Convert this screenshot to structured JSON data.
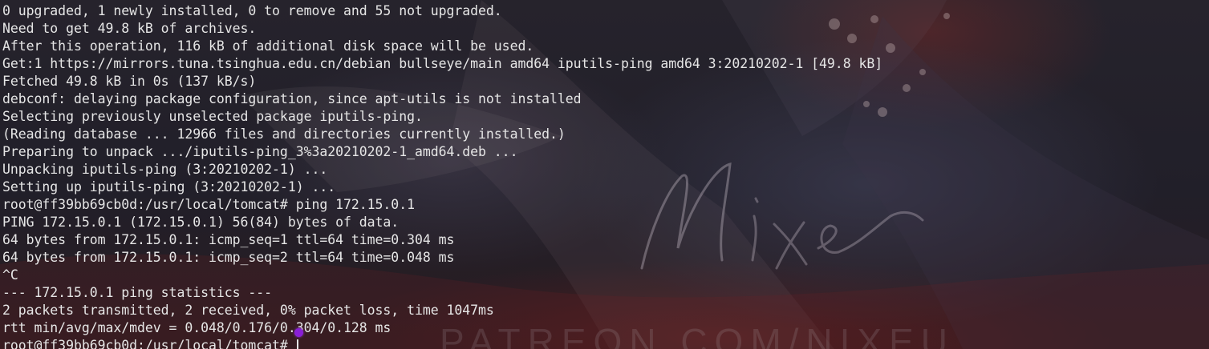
{
  "terminal": {
    "lines": [
      "0 upgraded, 1 newly installed, 0 to remove and 55 not upgraded.",
      "Need to get 49.8 kB of archives.",
      "After this operation, 116 kB of additional disk space will be used.",
      "Get:1 https://mirrors.tuna.tsinghua.edu.cn/debian bullseye/main amd64 iputils-ping amd64 3:20210202-1 [49.8 kB]",
      "Fetched 49.8 kB in 0s (137 kB/s)",
      "debconf: delaying package configuration, since apt-utils is not installed",
      "Selecting previously unselected package iputils-ping.",
      "(Reading database ... 12966 files and directories currently installed.)",
      "Preparing to unpack .../iputils-ping_3%3a20210202-1_amd64.deb ...",
      "Unpacking iputils-ping (3:20210202-1) ...",
      "Setting up iputils-ping (3:20210202-1) ...",
      "root@ff39bb69cb0d:/usr/local/tomcat# ping 172.15.0.1",
      "PING 172.15.0.1 (172.15.0.1) 56(84) bytes of data.",
      "64 bytes from 172.15.0.1: icmp_seq=1 ttl=64 time=0.304 ms",
      "64 bytes from 172.15.0.1: icmp_seq=2 ttl=64 time=0.048 ms",
      "^C",
      "--- 172.15.0.1 ping statistics ---",
      "2 packets transmitted, 2 received, 0% packet loss, time 1047ms",
      "rtt min/avg/max/mdev = 0.048/0.176/0.304/0.128 ms"
    ],
    "prompt": "root@ff39bb69cb0d:/usr/local/tomcat# "
  },
  "wallpaper": {
    "signature": "Nixeu",
    "url": "PATREON.COM/NIXEU"
  },
  "colors": {
    "text": "#e6e6e6",
    "pointer": "#8a1fd6"
  }
}
